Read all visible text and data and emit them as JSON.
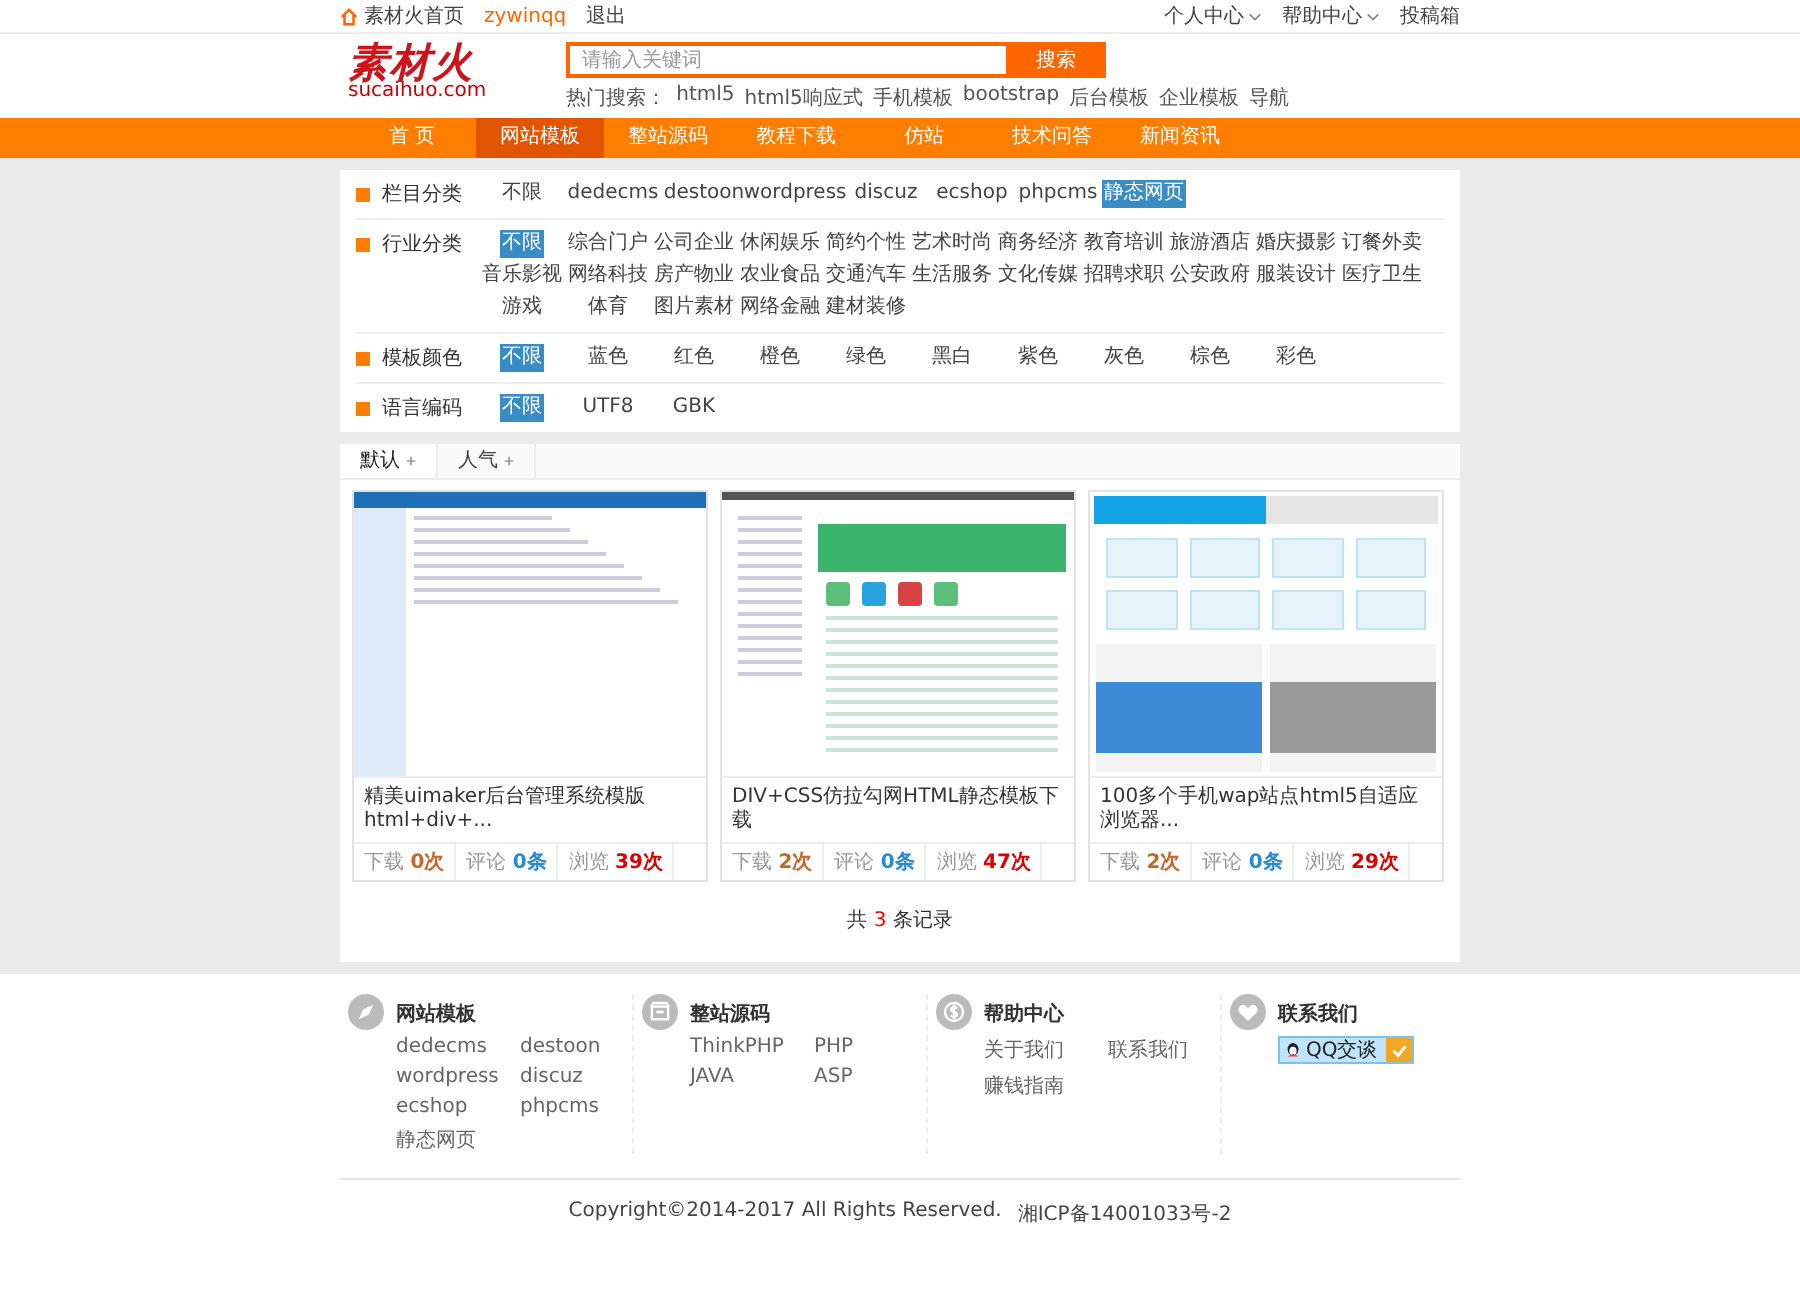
{
  "top_bar": {
    "left": [
      {
        "text": "素材火首页",
        "kind": "home"
      },
      {
        "text": "zywinqq",
        "kind": "user"
      },
      {
        "text": "退出",
        "kind": "link"
      }
    ],
    "right": [
      {
        "text": "个人中心",
        "dropdown": true
      },
      {
        "text": "帮助中心",
        "dropdown": true
      },
      {
        "text": "投稿箱",
        "dropdown": false
      }
    ]
  },
  "logo": {
    "name": "素材火",
    "domain": "sucaihuo.com"
  },
  "search": {
    "placeholder": "请输入关键词",
    "button": "搜索"
  },
  "hot_search": {
    "label": "热门搜索：",
    "terms": [
      "html5",
      "html5响应式",
      "手机模板",
      "bootstrap",
      "后台模板",
      "企业模板",
      "导航"
    ]
  },
  "nav": [
    {
      "label": "首 页",
      "selected": false
    },
    {
      "label": "网站模板",
      "selected": true
    },
    {
      "label": "整站源码",
      "selected": false
    },
    {
      "label": "教程下载",
      "selected": false
    },
    {
      "label": "仿站",
      "selected": false
    },
    {
      "label": "技术问答",
      "selected": false
    },
    {
      "label": "新闻资讯",
      "selected": false
    }
  ],
  "filters": [
    {
      "label": "栏目分类",
      "options": [
        {
          "text": "不限",
          "selected": false
        },
        {
          "text": "dedecms",
          "selected": false
        },
        {
          "text": "destoon",
          "selected": false
        },
        {
          "text": "wordpress",
          "selected": false
        },
        {
          "text": "discuz",
          "selected": false
        },
        {
          "text": "ecshop",
          "selected": false
        },
        {
          "text": "phpcms",
          "selected": false
        },
        {
          "text": "静态网页",
          "selected": true
        }
      ]
    },
    {
      "label": "行业分类",
      "options": [
        {
          "text": "不限",
          "selected": true
        },
        {
          "text": "综合门户",
          "selected": false
        },
        {
          "text": "公司企业",
          "selected": false
        },
        {
          "text": "休闲娱乐",
          "selected": false
        },
        {
          "text": "简约个性",
          "selected": false
        },
        {
          "text": "艺术时尚",
          "selected": false
        },
        {
          "text": "商务经济",
          "selected": false
        },
        {
          "text": "教育培训",
          "selected": false
        },
        {
          "text": "旅游酒店",
          "selected": false
        },
        {
          "text": "婚庆摄影",
          "selected": false
        },
        {
          "text": "订餐外卖",
          "selected": false
        },
        {
          "text": "音乐影视",
          "selected": false
        },
        {
          "text": "网络科技",
          "selected": false
        },
        {
          "text": "房产物业",
          "selected": false
        },
        {
          "text": "农业食品",
          "selected": false
        },
        {
          "text": "交通汽车",
          "selected": false
        },
        {
          "text": "生活服务",
          "selected": false
        },
        {
          "text": "文化传媒",
          "selected": false
        },
        {
          "text": "招聘求职",
          "selected": false
        },
        {
          "text": "公安政府",
          "selected": false
        },
        {
          "text": "服装设计",
          "selected": false
        },
        {
          "text": "医疗卫生",
          "selected": false
        },
        {
          "text": "游戏",
          "selected": false
        },
        {
          "text": "体育",
          "selected": false
        },
        {
          "text": "图片素材",
          "selected": false
        },
        {
          "text": "网络金融",
          "selected": false
        },
        {
          "text": "建材装修",
          "selected": false
        }
      ]
    },
    {
      "label": "模板颜色",
      "options": [
        {
          "text": "不限",
          "selected": true
        },
        {
          "text": "蓝色",
          "selected": false
        },
        {
          "text": "红色",
          "selected": false
        },
        {
          "text": "橙色",
          "selected": false
        },
        {
          "text": "绿色",
          "selected": false
        },
        {
          "text": "黑白",
          "selected": false
        },
        {
          "text": "紫色",
          "selected": false
        },
        {
          "text": "灰色",
          "selected": false
        },
        {
          "text": "棕色",
          "selected": false
        },
        {
          "text": "彩色",
          "selected": false
        }
      ]
    },
    {
      "label": "语言编码",
      "options": [
        {
          "text": "不限",
          "selected": true
        },
        {
          "text": "UTF8",
          "selected": false
        },
        {
          "text": "GBK",
          "selected": false
        }
      ]
    }
  ],
  "sort_tabs": [
    {
      "label": "默认",
      "selected": true
    },
    {
      "label": "人气",
      "selected": false
    }
  ],
  "templates": [
    {
      "title": "精美uimaker后台管理系统模版html+div+...",
      "kind": "admin",
      "stats": [
        {
          "kind": "downloads",
          "label": "下载",
          "value": "0次"
        },
        {
          "kind": "comments",
          "label": "评论",
          "value": "0条"
        },
        {
          "kind": "views",
          "label": "浏览",
          "value": "39次"
        }
      ]
    },
    {
      "title": "DIV+CSS仿拉勾网HTML静态模板下载",
      "kind": "jobs",
      "stats": [
        {
          "kind": "downloads",
          "label": "下载",
          "value": "2次"
        },
        {
          "kind": "comments",
          "label": "评论",
          "value": "0条"
        },
        {
          "kind": "views",
          "label": "浏览",
          "value": "47次"
        }
      ]
    },
    {
      "title": "100多个手机wap站点html5自适应浏览器...",
      "kind": "mobile",
      "stats": [
        {
          "kind": "downloads",
          "label": "下载",
          "value": "2次"
        },
        {
          "kind": "comments",
          "label": "评论",
          "value": "0条"
        },
        {
          "kind": "views",
          "label": "浏览",
          "value": "29次"
        }
      ]
    }
  ],
  "pagination": {
    "prefix": "共",
    "count": "3",
    "suffix": "条记录"
  },
  "footer": {
    "columns": [
      {
        "title": "网站模板",
        "kind": "compass",
        "links": [
          "dedecms",
          "destoon",
          "wordpress",
          "discuz",
          "ecshop",
          "phpcms",
          "静态网页"
        ]
      },
      {
        "title": "整站源码",
        "kind": "box",
        "links": [
          "ThinkPHP",
          "PHP",
          "JAVA",
          "ASP"
        ]
      },
      {
        "title": "帮助中心",
        "kind": "coin",
        "links": [
          "关于我们",
          "联系我们",
          "赚钱指南"
        ]
      },
      {
        "title": "联系我们",
        "kind": "heart",
        "qq_button": "QQ交谈"
      }
    ]
  },
  "copyright": "Copyright©2014-2017 All Rights Reserved.",
  "icp": "湘ICP备14001033号-2"
}
